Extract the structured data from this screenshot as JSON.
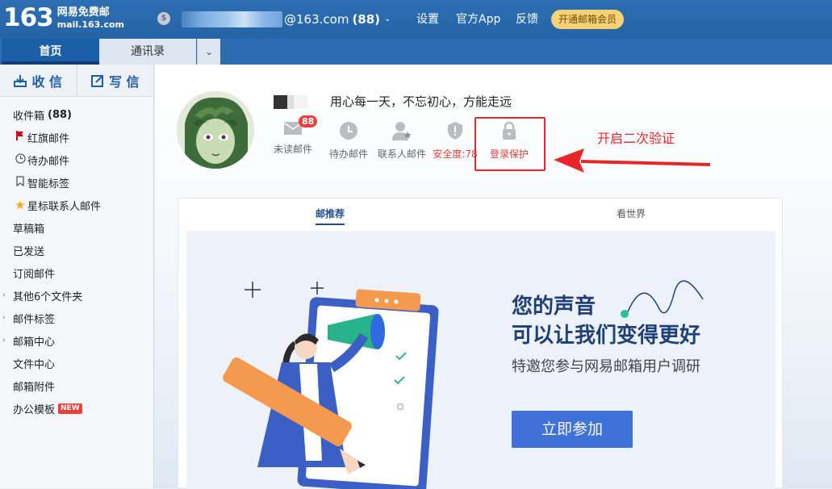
{
  "brand": {
    "number": "163",
    "name": "网易免费邮",
    "url": "mail.163.com"
  },
  "header": {
    "account_suffix": "@163.com",
    "unread_count": "(88)",
    "nav": [
      "设置",
      "官方App",
      "反馈"
    ],
    "vip_button": "开通邮箱会员"
  },
  "tabs": [
    {
      "label": "首页"
    },
    {
      "label": "通讯录"
    }
  ],
  "sidebar": {
    "receive": "收 信",
    "compose": "写 信",
    "inbox_label": "收件箱",
    "inbox_count": "(88)",
    "items": [
      {
        "label": "红旗邮件",
        "icon": "flag-icon"
      },
      {
        "label": "待办邮件",
        "icon": "clock-icon"
      },
      {
        "label": "智能标签",
        "icon": "bookmark-icon"
      },
      {
        "label": "星标联系人邮件",
        "icon": "star-icon"
      },
      {
        "label": "草稿箱"
      },
      {
        "label": "已发送"
      },
      {
        "label": "订阅邮件"
      },
      {
        "label": "其他6个文件夹"
      },
      {
        "label": "邮件标签"
      },
      {
        "label": "邮箱中心"
      },
      {
        "label": "文件中心"
      },
      {
        "label": "邮箱附件"
      },
      {
        "label": "办公模板"
      }
    ],
    "new_tag": "NEW"
  },
  "profile": {
    "motto": "用心每一天，不忘初心，方能走远",
    "unread_badge": "88",
    "quick_items": [
      {
        "label": "未读邮件",
        "icon": "mail-icon"
      },
      {
        "label": "待办邮件",
        "icon": "clock-icon"
      },
      {
        "label": "联系人邮件",
        "icon": "contact-star-icon"
      },
      {
        "label": "安全度:78",
        "icon": "shield-icon"
      },
      {
        "label": "登录保护",
        "icon": "lock-icon"
      }
    ]
  },
  "annotation": "开启二次验证",
  "content_tabs": [
    "邮推荐",
    "看世界"
  ],
  "banner": {
    "title_line1": "您的声音",
    "title_line2": "可以让我们变得更好",
    "subtitle": "特邀您参与网易邮箱用户调研",
    "button": "立即参加"
  },
  "colors": {
    "accent": "#2563a6",
    "warning_red": "#e8262a",
    "banner_button": "#3f71d8"
  }
}
